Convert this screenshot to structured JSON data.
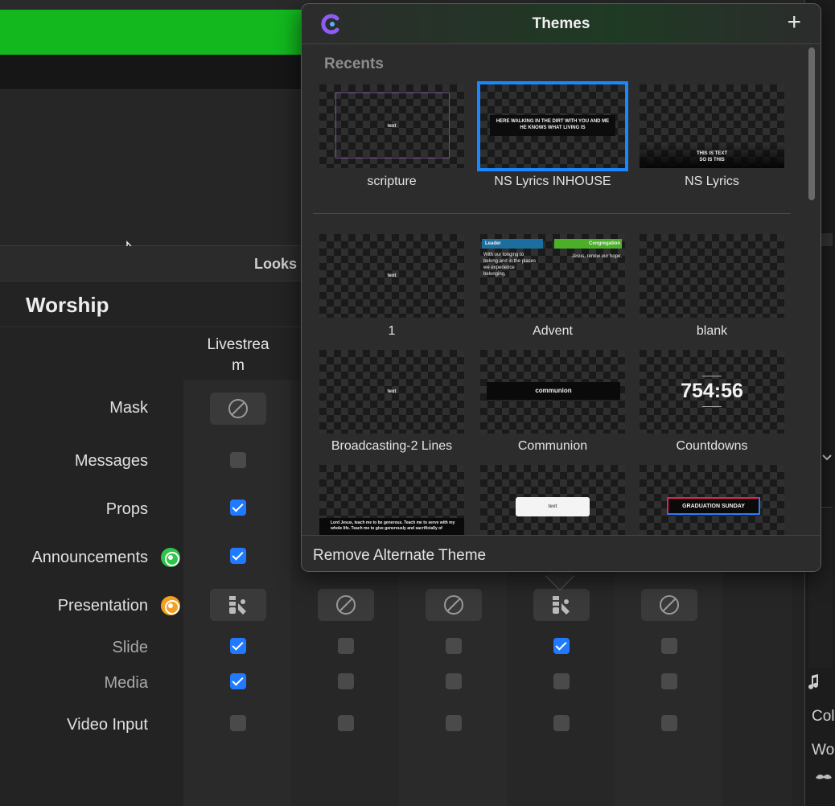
{
  "looks_panel": {
    "title": "Looks"
  },
  "worship": {
    "title": "Worship",
    "column_header": "Livestrea\nm",
    "rows": {
      "mask": "Mask",
      "messages": "Messages",
      "props": "Props",
      "announcements": "Announcements",
      "presentation": "Presentation",
      "slide": "Slide",
      "media": "Media",
      "video_input": "Video Input"
    }
  },
  "right_edge": {
    "col": "Col",
    "wo": "Wo"
  },
  "themes_popover": {
    "title": "Themes",
    "add_label": "+",
    "recents_label": "Recents",
    "recents": [
      {
        "label": "scripture",
        "preview_text": "text"
      },
      {
        "label": "NS Lyrics INHOUSE",
        "preview_text": "HERE WALKING IN THE DIRT WITH YOU AND ME\nHE KNOWS WHAT LIVING IS",
        "selected": true
      },
      {
        "label": "NS Lyrics",
        "preview_text": "THIS IS TEXT\nSO IS THIS"
      }
    ],
    "themes": [
      {
        "label": "1",
        "preview_text": "text"
      },
      {
        "label": "Advent",
        "preview_leader": "Leader",
        "preview_congregation": "Congregation",
        "preview_left": "With our longing to belong and in the places we experience belonging,",
        "preview_right": "Jesus, renew our hope."
      },
      {
        "label": "blank"
      },
      {
        "label": "Broadcasting-2 Lines",
        "preview_text": "text"
      },
      {
        "label": "Communion",
        "preview_text": "communion"
      },
      {
        "label": "Countdowns",
        "preview_text": "754:56"
      },
      {
        "label": "",
        "preview_text": "Lord Jesus, teach me to be generous. Teach me to serve with my whole life. Teach me to give generously and sacrificially of"
      },
      {
        "label": "",
        "preview_text": "text"
      },
      {
        "label": "",
        "preview_text": "GRADUATION SUNDAY"
      }
    ],
    "footer_action": "Remove Alternate Theme"
  },
  "colors": {
    "accent_blue": "#1a86ff",
    "app_green": "#12b81e",
    "announcements_dot": "#2fc44a",
    "presentation_dot": "#f2a023"
  }
}
